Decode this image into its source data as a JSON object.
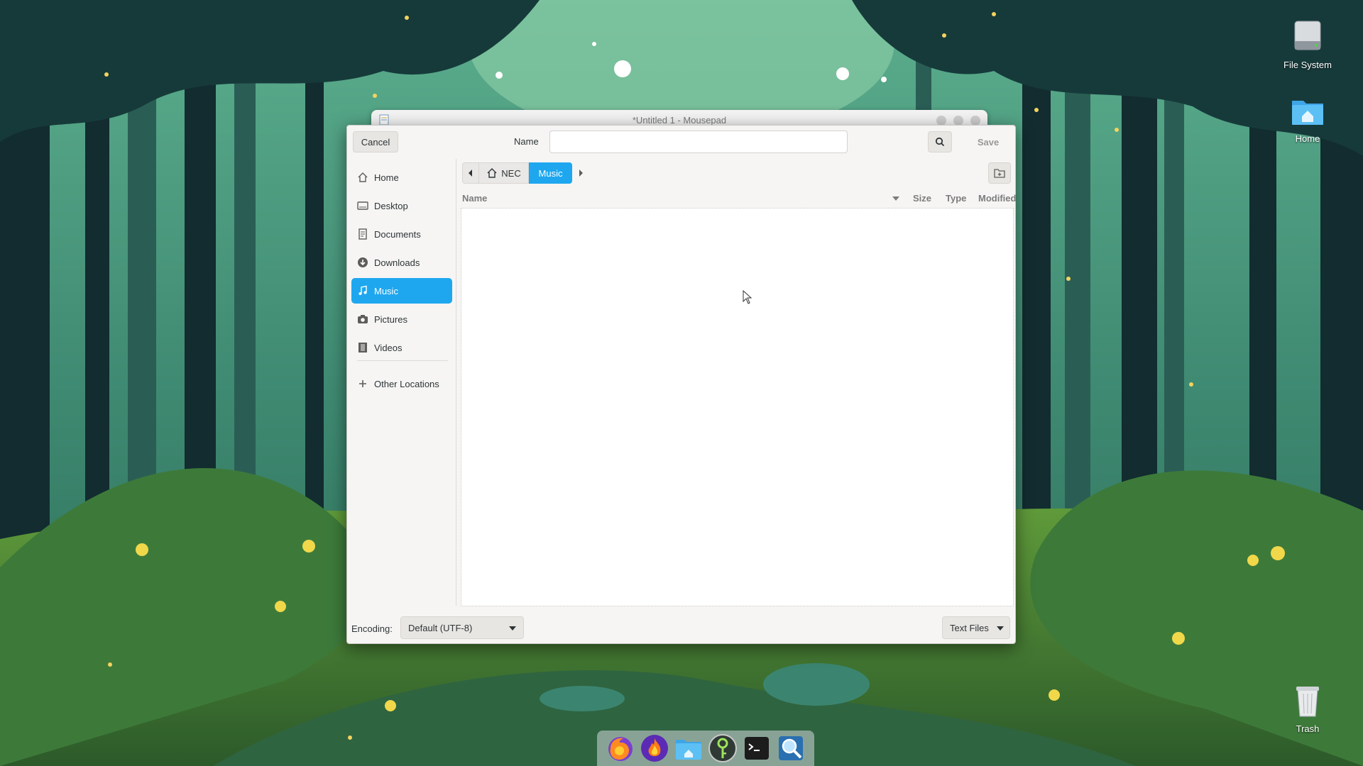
{
  "background_window": {
    "title": "*Untitled 1 - Mousepad"
  },
  "desktop_icons": [
    {
      "label": "File System",
      "icon": "drive-icon"
    },
    {
      "label": "Home",
      "icon": "home-folder-icon"
    },
    {
      "label": "Trash",
      "icon": "trash-icon"
    }
  ],
  "dialog": {
    "cancel_label": "Cancel",
    "save_label": "Save",
    "name_label": "Name",
    "name_value": "",
    "sidebar": {
      "items": [
        {
          "label": "Home",
          "icon": "home-icon"
        },
        {
          "label": "Desktop",
          "icon": "desktop-icon"
        },
        {
          "label": "Documents",
          "icon": "documents-icon"
        },
        {
          "label": "Downloads",
          "icon": "downloads-icon"
        },
        {
          "label": "Music",
          "icon": "music-icon",
          "active": true
        },
        {
          "label": "Pictures",
          "icon": "camera-icon"
        },
        {
          "label": "Videos",
          "icon": "film-icon"
        }
      ],
      "other_locations": "Other Locations"
    },
    "path": {
      "home_crumb": "NEC",
      "current_crumb": "Music"
    },
    "columns": {
      "name": "Name",
      "size": "Size",
      "type": "Type",
      "modified": "Modified"
    },
    "files": [],
    "encoding_label": "Encoding:",
    "encoding_value": "Default (UTF-8)",
    "filter_value": "Text Files"
  },
  "dock": [
    {
      "app": "Firefox",
      "icon": "firefox-icon"
    },
    {
      "app": "Flame",
      "icon": "flame-icon"
    },
    {
      "app": "Files",
      "icon": "files-icon"
    },
    {
      "app": "Keys",
      "icon": "keys-icon"
    },
    {
      "app": "Terminal",
      "icon": "terminal-icon"
    },
    {
      "app": "Search",
      "icon": "magnifier-icon"
    }
  ],
  "colors": {
    "accent": "#1ea7ef",
    "dialog_bg": "#f6f5f4"
  }
}
